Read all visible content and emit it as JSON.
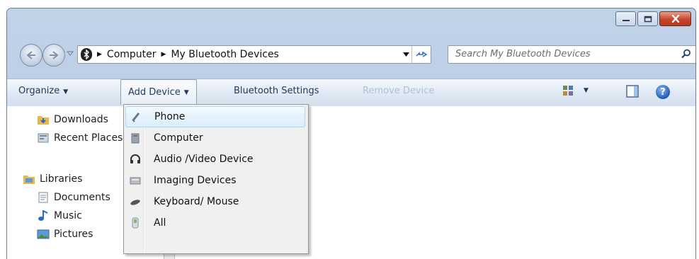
{
  "window": {
    "caption_buttons": [
      "minimize",
      "maximize",
      "close"
    ]
  },
  "address": {
    "crumbs": [
      "Computer",
      "My Bluetooth Devices"
    ]
  },
  "search": {
    "placeholder": "Search My Bluetooth Devices"
  },
  "toolbar": {
    "organize_label": "Organize",
    "add_device_label": "Add Device",
    "bluetooth_settings_label": "Bluetooth Settings",
    "remove_device_label": "Remove Device"
  },
  "nav": {
    "items": [
      {
        "label": "Downloads",
        "icon": "downloads-folder-icon"
      },
      {
        "label": "Recent Places",
        "icon": "recent-places-icon"
      },
      {
        "label": "Libraries",
        "icon": "libraries-icon"
      },
      {
        "label": "Documents",
        "icon": "documents-icon"
      },
      {
        "label": "Music",
        "icon": "music-icon"
      },
      {
        "label": "Pictures",
        "icon": "pictures-icon"
      }
    ]
  },
  "menu": {
    "items": [
      {
        "label": "Phone",
        "icon": "phone-icon",
        "highlighted": true
      },
      {
        "label": "Computer",
        "icon": "computer-icon"
      },
      {
        "label": "Audio /Video Device",
        "icon": "headphones-icon"
      },
      {
        "label": "Imaging Devices",
        "icon": "scanner-icon"
      },
      {
        "label": "Keyboard/ Mouse",
        "icon": "mouse-icon"
      },
      {
        "label": "All",
        "icon": "all-devices-icon"
      }
    ]
  },
  "colors": {
    "frame": "#b9cce4",
    "toolbar_text": "#1e395b",
    "menu_highlight": "#dbeefc"
  }
}
